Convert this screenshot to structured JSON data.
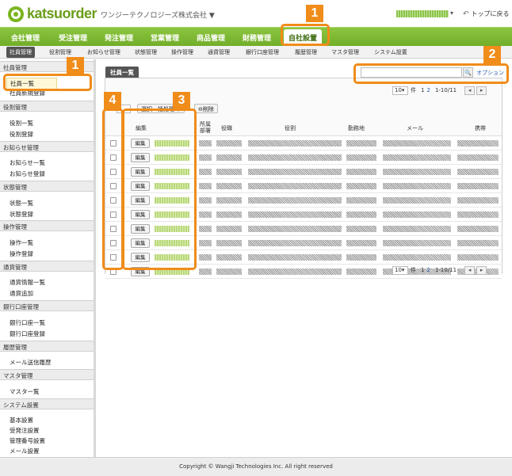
{
  "header": {
    "logo_text": "katsuorder",
    "company": "ワンジーテクノロジーズ株式会社 ▼",
    "user_caret": "▾",
    "back_to_top": "トップに戻る"
  },
  "main_nav": [
    {
      "label": "会社管理"
    },
    {
      "label": "受注管理"
    },
    {
      "label": "発注管理"
    },
    {
      "label": "営業管理"
    },
    {
      "label": "商品管理"
    },
    {
      "label": "財務管理"
    },
    {
      "label": "自社設置",
      "active": true
    }
  ],
  "sub_nav": [
    {
      "label": "社員管理",
      "active": true
    },
    {
      "label": "役割管理"
    },
    {
      "label": "お知らせ管理"
    },
    {
      "label": "状態管理"
    },
    {
      "label": "操作管理"
    },
    {
      "label": "通貨管理"
    },
    {
      "label": "銀行口座管理"
    },
    {
      "label": "履歴管理"
    },
    {
      "label": "マスタ管理"
    },
    {
      "label": "システム設置"
    }
  ],
  "sidebar": {
    "sections": [
      {
        "title": "社員管理",
        "items": [
          "社員一覧",
          "社員新規登録"
        ]
      },
      {
        "title": "役割管理",
        "items": [
          "役割一覧",
          "役割登録"
        ]
      },
      {
        "title": "お知らせ管理",
        "items": [
          "お知らせ一覧",
          "お知らせ登録"
        ]
      },
      {
        "title": "状態管理",
        "items": [
          "状態一覧",
          "状態登録"
        ]
      },
      {
        "title": "操作管理",
        "items": [
          "操作一覧",
          "操作登録"
        ]
      },
      {
        "title": "通貨管理",
        "items": [
          "通貨情報一覧",
          "通貨追加"
        ]
      },
      {
        "title": "銀行口座管理",
        "items": [
          "銀行口座一覧",
          "銀行口座登録"
        ]
      },
      {
        "title": "履歴管理",
        "items": [
          "メール送信履歴"
        ]
      },
      {
        "title": "マスタ管理",
        "items": [
          "マスター覧"
        ]
      },
      {
        "title": "システム設置",
        "items": [
          "基本設置",
          "受発注設置",
          "管理番号設置",
          "メール設置"
        ]
      }
    ]
  },
  "content": {
    "tab_label": "社員一覧",
    "search_placeholder": "",
    "search_icon_glyph": "🔍",
    "option_label": "オプション",
    "bulk_action_label": "選択一括処理 ▼",
    "delete_label": "⊖削除",
    "pager": {
      "per_page": "10",
      "per_page_caret": "▾",
      "unit": "件",
      "page_1": "1",
      "page_2": "2",
      "range": "1-10/11",
      "prev": "◂",
      "next": "▸"
    },
    "columns": [
      "編集",
      "所属部署",
      "役職",
      "役割",
      "勤務地",
      "メール",
      "携帯"
    ],
    "edit_button": "編集",
    "row_count": 10
  },
  "annotations": {
    "marker_1a": "1",
    "marker_1b": "1",
    "marker_2": "2",
    "marker_3": "3",
    "marker_4": "4"
  },
  "footer": {
    "copyright": "Copyright © Wangji Technologies Inc. All right reserved"
  }
}
